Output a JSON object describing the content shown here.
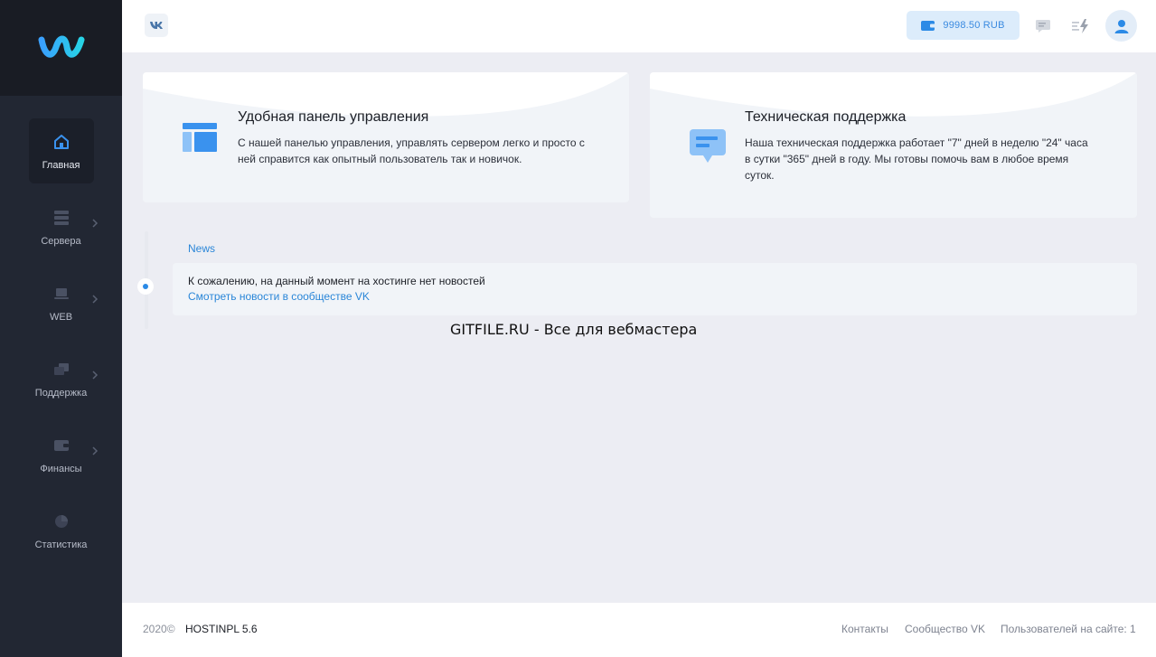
{
  "sidebar": {
    "logo": "hostinpl-logo",
    "items": [
      {
        "label": "Главная",
        "icon": "home-icon",
        "active": true
      },
      {
        "label": "Сервера",
        "icon": "server-icon"
      },
      {
        "label": "WEB",
        "icon": "laptop-icon"
      },
      {
        "label": "Поддержка",
        "icon": "support-icon"
      },
      {
        "label": "Финансы",
        "icon": "wallet-icon"
      },
      {
        "label": "Статистика",
        "icon": "pie-chart-icon"
      }
    ]
  },
  "topbar": {
    "vk_icon": "vk-icon",
    "balance": "9998.50 RUB",
    "icons": [
      "chat-icon",
      "flash-icon",
      "user-icon"
    ]
  },
  "cards": [
    {
      "title": "Удобная панель управления",
      "text_line1": "С нашей панелью управления, управлять сервером легко и просто с",
      "text_line2": "ней справится как опытный пользователь так и новичок.",
      "icon": "dashboard-layout-icon"
    },
    {
      "title": "Техническая поддержка",
      "text_line1": "Наша техническая поддержка работает \"7\" дней в неделю \"24\" часа",
      "text_line2": "в сутки \"365\" дней в году. Мы готовы помочь вам в любое время",
      "text_line3": "суток.",
      "icon": "message-bubble-icon"
    }
  ],
  "news": {
    "title": "News",
    "text": "К сожалению, на данный момент на хостинге нет новостей",
    "link": "Смотреть новости в сообществе VK"
  },
  "watermark": "GITFILE.RU - Все для вебмастера",
  "footer": {
    "year": "2020©",
    "brand": "HOSTINPL 5.6",
    "contacts": "Контакты",
    "vk_community": "Сообщество VK",
    "online": "Пользователей на сайте: 1"
  },
  "colors": {
    "accent": "#2b8ae6",
    "sidebar_bg": "#222733",
    "page_bg": "#ecedf3"
  }
}
